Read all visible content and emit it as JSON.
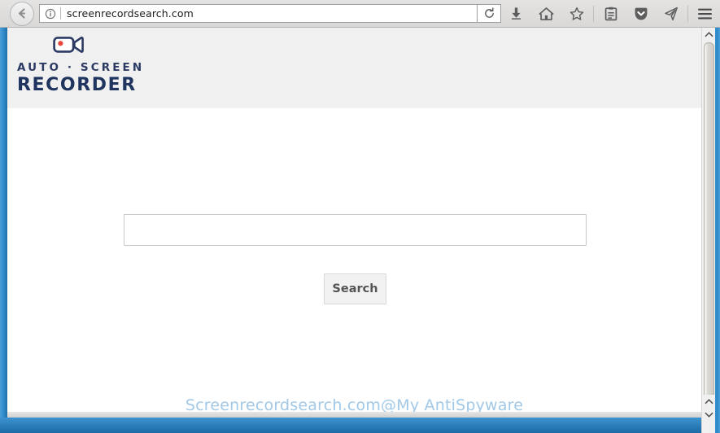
{
  "browser": {
    "back_button": "back-button",
    "url": "screenrecordsearch.com",
    "reload_label": "reload",
    "toolbar_icons": [
      {
        "name": "download-icon",
        "label": "Downloads"
      },
      {
        "name": "home-icon",
        "label": "Home"
      },
      {
        "name": "star-icon",
        "label": "Bookmark this page"
      },
      {
        "name": "library-icon",
        "label": "Library"
      },
      {
        "name": "pocket-icon",
        "label": "Save to Pocket"
      },
      {
        "name": "send-icon",
        "label": "Send tab"
      },
      {
        "name": "menu-icon",
        "label": "Open menu"
      }
    ]
  },
  "site": {
    "logo": {
      "line1": "AUTO · SCREEN",
      "line2": "RECORDER",
      "icon": "video-camera-icon",
      "record_dot_color": "#e8463c",
      "text_color": "#1f3560"
    },
    "search": {
      "value": "",
      "placeholder": "",
      "button_label": "Search"
    },
    "watermark": "Screenrecordsearch.com@My AntiSpyware"
  },
  "colors": {
    "page_border_blue": "#2e87c6",
    "header_bg": "#f0f0f0",
    "chrome_bg": "#dedede"
  }
}
